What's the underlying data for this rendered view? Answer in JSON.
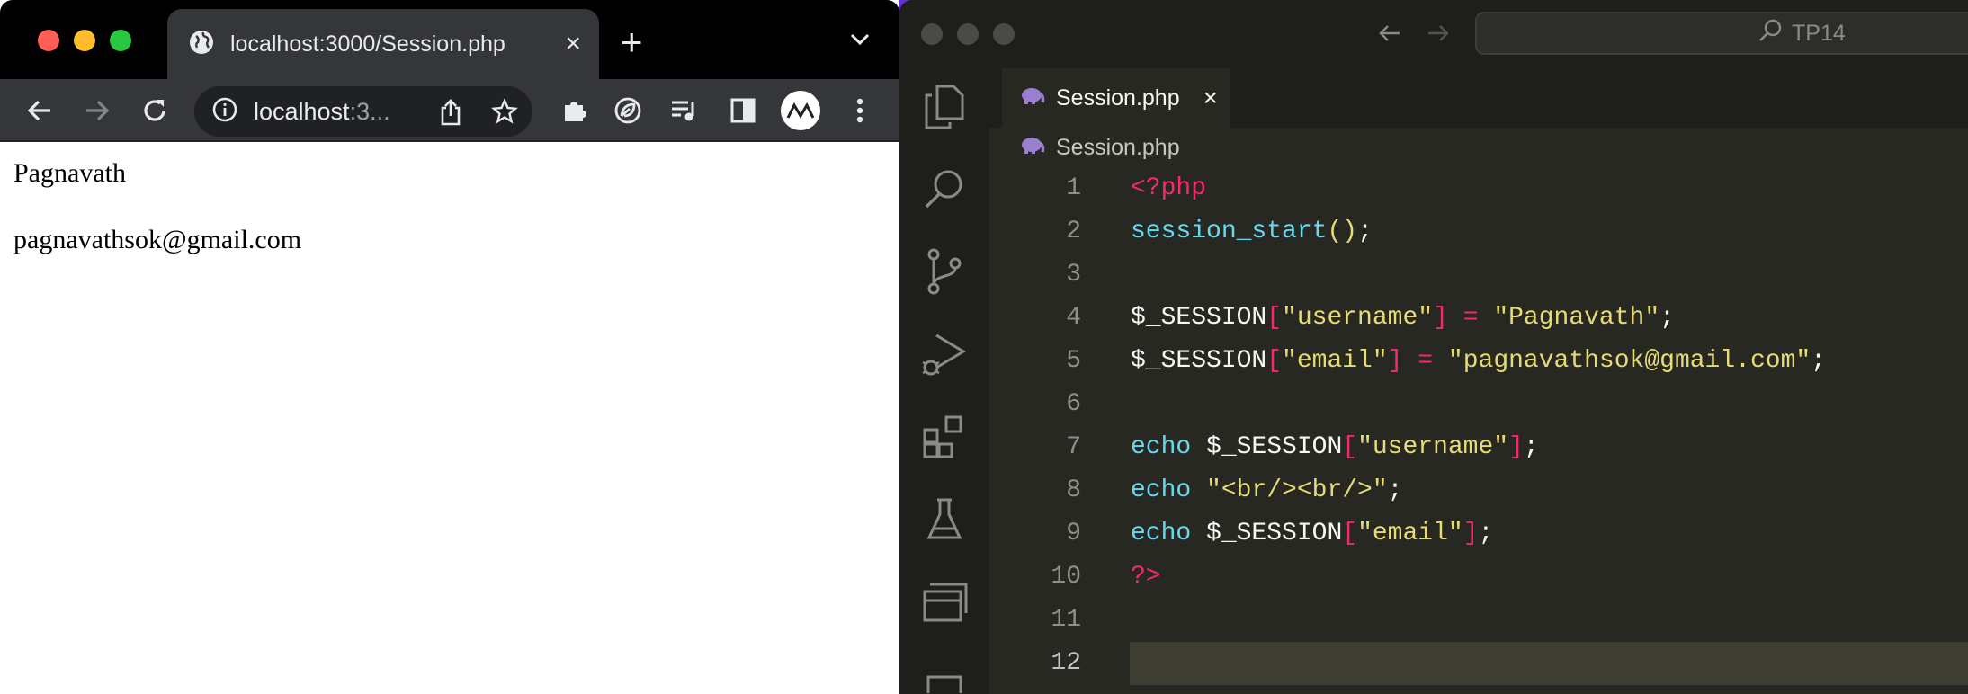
{
  "browser": {
    "tab_title": "localhost:3000/Session.php",
    "omnibox_host": "localhost",
    "omnibox_rest": ":3...",
    "page_lines": [
      "Pagnavath",
      "pagnavathsok@gmail.com"
    ]
  },
  "editor": {
    "search_text": "TP14",
    "tab_label": "Session.php",
    "breadcrumb_file": "Session.php",
    "line_numbers": [
      "1",
      "2",
      "3",
      "4",
      "5",
      "6",
      "7",
      "8",
      "9",
      "10",
      "11",
      "12"
    ],
    "code": {
      "l1": [
        "<?php"
      ],
      "l2": [
        "session_start",
        "(",
        ")",
        ";"
      ],
      "l4": [
        "$_SESSION",
        "[",
        "\"username\"",
        "]",
        " = ",
        "\"Pagnavath\"",
        ";"
      ],
      "l5": [
        "$_SESSION",
        "[",
        "\"email\"",
        "]",
        " = ",
        "\"pagnavathsok@gmail.com\"",
        ";"
      ],
      "l7": [
        "echo",
        " $_SESSION",
        "[",
        "\"username\"",
        "]",
        ";"
      ],
      "l8": [
        "echo",
        " ",
        "\"<br/><br/>\"",
        ";"
      ],
      "l9": [
        "echo",
        " $_SESSION",
        "[",
        "\"email\"",
        "]",
        ";"
      ],
      "l10": [
        "?>"
      ]
    },
    "current_line": "12"
  },
  "colors": {
    "desktop": "#6b2fd6",
    "editor_bg": "#272822",
    "keyword_pink": "#f92672",
    "function_cyan": "#66d9ef",
    "string_yellow": "#e6db74"
  },
  "icons": [
    "globe-icon",
    "close-icon",
    "plus-icon",
    "chevron-down-icon",
    "back-arrow-icon",
    "forward-arrow-icon",
    "reload-icon",
    "info-icon",
    "share-icon",
    "star-icon",
    "puzzle-icon",
    "leaf-icon",
    "queue-music-icon",
    "sidepanel-icon",
    "profile-avatar-icon",
    "kebab-menu-icon",
    "files-icon",
    "search-icon",
    "source-control-icon",
    "run-debug-icon",
    "extensions-icon",
    "testing-icon",
    "remote-explorer-icon",
    "php-elephant-icon"
  ]
}
